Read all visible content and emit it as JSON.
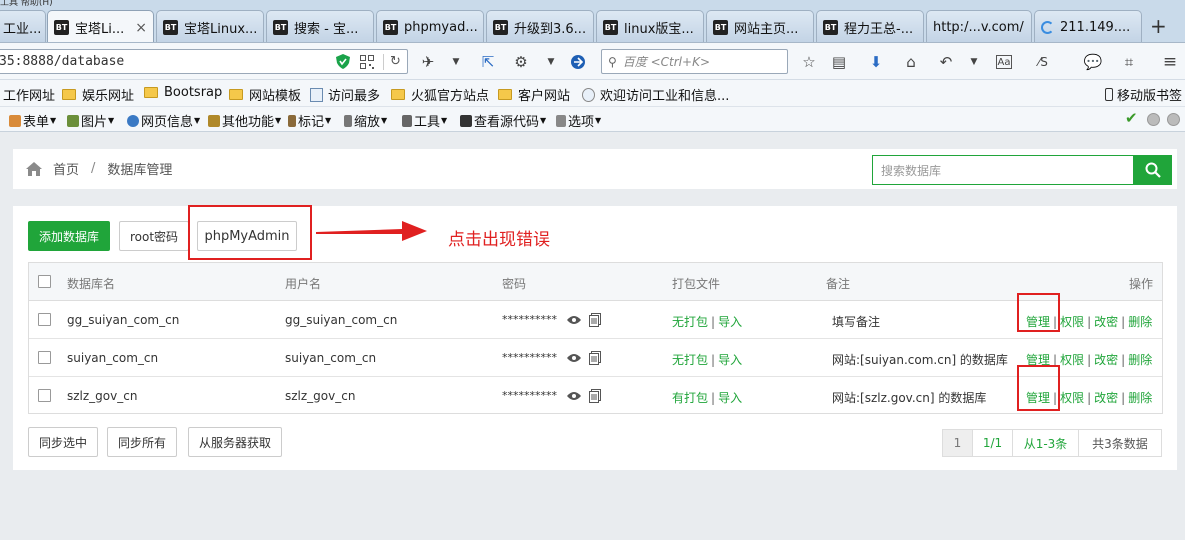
{
  "browser": {
    "top_strip": "工具  帮助(H)",
    "tabs": [
      {
        "label": "工业...",
        "icon": "page-icon"
      },
      {
        "label": "宝塔Li...",
        "icon": "bt-icon",
        "active": true,
        "close": "×"
      },
      {
        "label": "宝塔Linux...",
        "icon": "bt-icon"
      },
      {
        "label": "搜索 - 宝...",
        "icon": "bt-icon"
      },
      {
        "label": "phpmyad...",
        "icon": "bt-icon"
      },
      {
        "label": "升级到3.6...",
        "icon": "bt-icon"
      },
      {
        "label": "linux版宝...",
        "icon": "bt-icon"
      },
      {
        "label": "网站主页...",
        "icon": "bt-icon"
      },
      {
        "label": "程力王总-...",
        "icon": "bt-icon"
      },
      {
        "label": "http:/...v.com/",
        "icon": "page-icon"
      },
      {
        "label": "211.149....",
        "icon": "loading-icon"
      }
    ],
    "bt_badge": "BT",
    "new_tab": "+",
    "url": "35:8888/database",
    "search_placeholder": "百度 <Ctrl+K>",
    "bookmarks": [
      "工作网址",
      "娱乐网址",
      "Bootsrap",
      "网站模板",
      "访问最多",
      "火狐官方站点",
      "客户网站",
      "欢迎访问工业和信息...",
      "移动版书签"
    ],
    "toolbar2": [
      "表单",
      "图片",
      "网页信息",
      "其他功能",
      "标记",
      "缩放",
      "工具",
      "查看源代码",
      "选项"
    ]
  },
  "breadcrumb": {
    "home": "首页",
    "separator": "/",
    "current": "数据库管理"
  },
  "search": {
    "placeholder": "搜索数据库"
  },
  "buttons": {
    "add_db": "添加数据库",
    "root_pwd": "root密码",
    "phpmyadmin": "phpMyAdmin"
  },
  "annotation": "点击出现错误",
  "table": {
    "headers": {
      "name": "数据库名",
      "user": "用户名",
      "password": "密码",
      "backup": "打包文件",
      "note": "备注",
      "actions": "操作"
    },
    "rows": [
      {
        "name": "gg_suiyan_com_cn",
        "user": "gg_suiyan_com_cn",
        "password": "**********",
        "backup": "无打包",
        "import": "导入",
        "note": "填写备注"
      },
      {
        "name": "suiyan_com_cn",
        "user": "suiyan_com_cn",
        "password": "**********",
        "backup": "无打包",
        "import": "导入",
        "note": "网站:[suiyan.com.cn] 的数据库"
      },
      {
        "name": "szlz_gov_cn",
        "user": "szlz_gov_cn",
        "password": "**********",
        "backup": "有打包",
        "import": "导入",
        "note": "网站:[szlz.gov.cn] 的数据库"
      }
    ],
    "actions": {
      "manage": "管理",
      "perm": "权限",
      "chpwd": "改密",
      "delete": "删除",
      "sep": "|"
    }
  },
  "footer_buttons": {
    "sync_selected": "同步选中",
    "sync_all": "同步所有",
    "fetch_server": "从服务器获取"
  },
  "pagination": {
    "current": "1",
    "pages": "1/1",
    "range": "从1-3条",
    "total": "共3条数据"
  },
  "colors": {
    "accent_green": "#20a53a",
    "annotation_red": "#e02020"
  }
}
